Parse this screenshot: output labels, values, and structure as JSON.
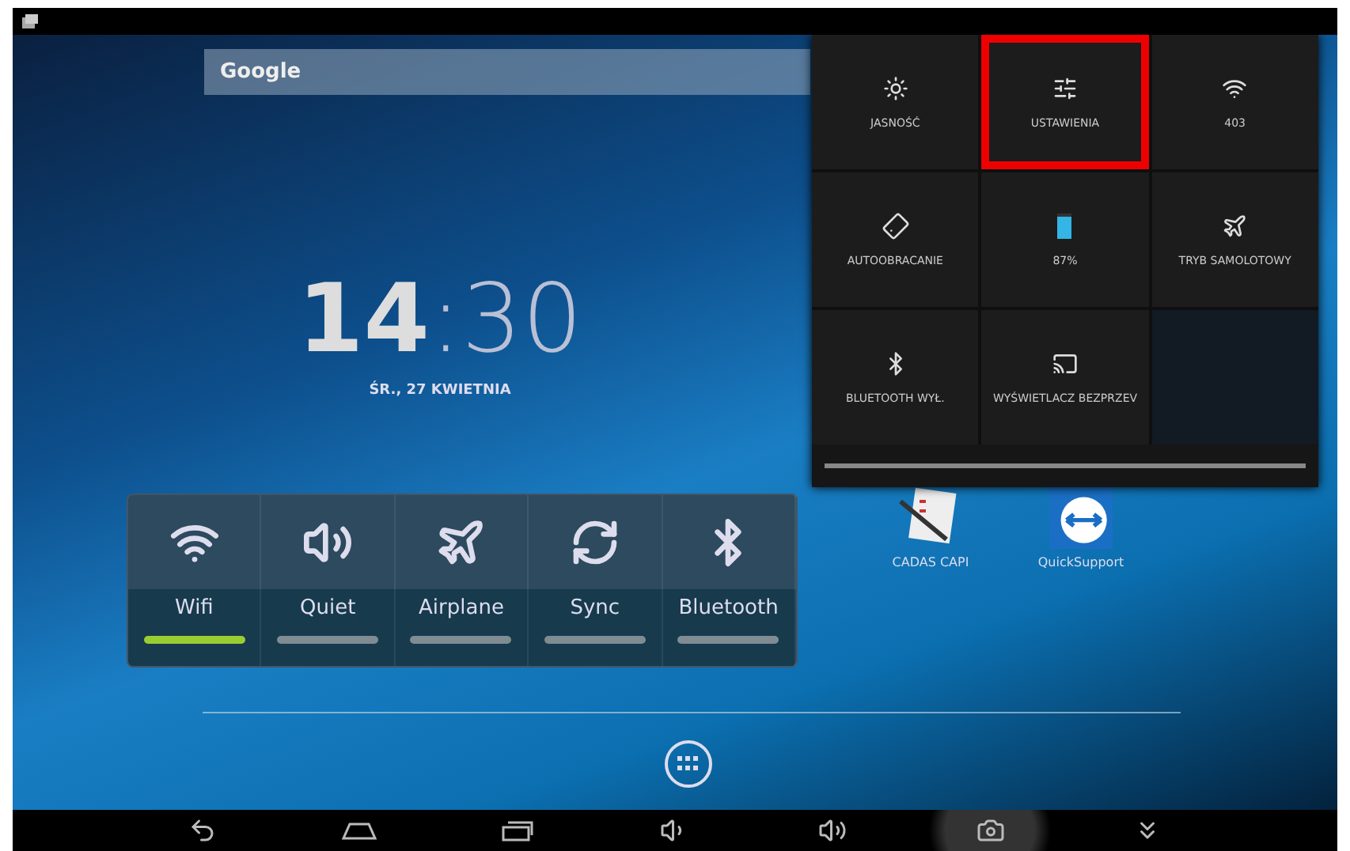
{
  "search": {
    "placeholder": "Google"
  },
  "clock": {
    "hours": "14",
    "separator": ":",
    "minutes": "30",
    "date": "ŚR., 27 KWIETNIA"
  },
  "power_widget": {
    "toggles": [
      {
        "kind": "wifi",
        "label": "Wifi",
        "on": true
      },
      {
        "kind": "sound",
        "label": "Quiet",
        "on": false
      },
      {
        "kind": "airplane",
        "label": "Airplane",
        "on": false
      },
      {
        "kind": "sync",
        "label": "Sync",
        "on": false
      },
      {
        "kind": "bluetooth",
        "label": "Bluetooth",
        "on": false
      }
    ]
  },
  "apps": [
    {
      "kind": "checklist",
      "label": "CADAS CAPI"
    },
    {
      "kind": "remote",
      "label": "QuickSupport"
    }
  ],
  "quick_settings": {
    "tiles": [
      {
        "kind": "brightness",
        "label": "JASNOŚĆ",
        "highlighted": false
      },
      {
        "kind": "settings",
        "label": "USTAWIENIA",
        "highlighted": true
      },
      {
        "kind": "wifi",
        "label": "403",
        "highlighted": false
      },
      {
        "kind": "rotate",
        "label": "AUTOOBRACANIE",
        "highlighted": false
      },
      {
        "kind": "battery",
        "label": "87%",
        "highlighted": false,
        "level": 0.87
      },
      {
        "kind": "airplane",
        "label": "TRYB SAMOLOTOWY",
        "highlighted": false
      },
      {
        "kind": "bluetooth",
        "label": "BLUETOOTH WYŁ.",
        "highlighted": false
      },
      {
        "kind": "cast",
        "label": "WYŚWIETLACZ BEZPRZEV",
        "highlighted": false
      }
    ]
  },
  "nav_bar": {
    "buttons": [
      {
        "kind": "back",
        "pressed": false
      },
      {
        "kind": "home",
        "pressed": false
      },
      {
        "kind": "recents",
        "pressed": false
      },
      {
        "kind": "volume_down",
        "pressed": false
      },
      {
        "kind": "volume_up",
        "pressed": false
      },
      {
        "kind": "screenshot",
        "pressed": true
      },
      {
        "kind": "hide",
        "pressed": false
      }
    ]
  }
}
